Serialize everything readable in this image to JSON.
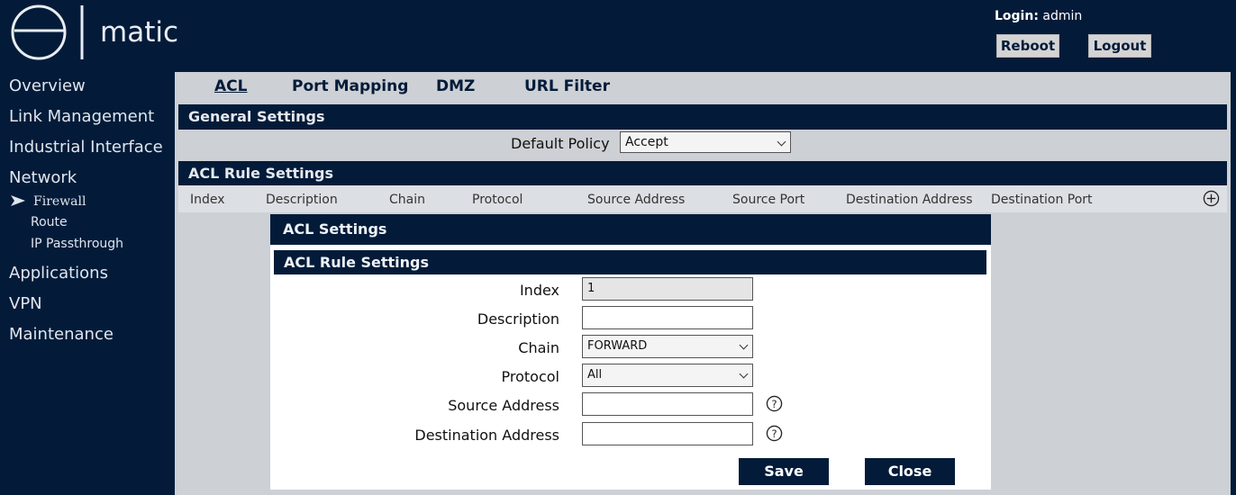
{
  "header": {
    "logo_text": "matic",
    "login_label": "Login:",
    "login_user": "admin",
    "reboot_label": "Reboot",
    "logout_label": "Logout"
  },
  "sidebar": {
    "items": [
      {
        "label": "Overview"
      },
      {
        "label": "Link Management"
      },
      {
        "label": "Industrial Interface"
      },
      {
        "label": "Network"
      },
      {
        "label": "Applications"
      },
      {
        "label": "VPN"
      },
      {
        "label": "Maintenance"
      }
    ],
    "subitems": [
      {
        "label": "Firewall",
        "active": true
      },
      {
        "label": "Route"
      },
      {
        "label": "IP Passthrough"
      }
    ]
  },
  "tabs": [
    {
      "label": "ACL",
      "active": true
    },
    {
      "label": "Port Mapping"
    },
    {
      "label": "DMZ"
    },
    {
      "label": "URL Filter"
    }
  ],
  "general": {
    "title": "General Settings",
    "policy_label": "Default Policy",
    "policy_value": "Accept"
  },
  "acl_rules": {
    "title": "ACL Rule Settings",
    "columns": [
      "Index",
      "Description",
      "Chain",
      "Protocol",
      "Source Address",
      "Source Port",
      "Destination Address",
      "Destination Port"
    ]
  },
  "modal": {
    "title": "ACL Settings",
    "subtitle": "ACL Rule Settings",
    "fields": {
      "index": {
        "label": "Index",
        "value": "1"
      },
      "description": {
        "label": "Description",
        "value": ""
      },
      "chain": {
        "label": "Chain",
        "value": "FORWARD"
      },
      "protocol": {
        "label": "Protocol",
        "value": "All"
      },
      "source": {
        "label": "Source Address",
        "value": ""
      },
      "destination": {
        "label": "Destination Address",
        "value": ""
      }
    },
    "save_label": "Save",
    "close_label": "Close"
  },
  "colors": {
    "navy": "#031b39",
    "panel": "#cdd0d4",
    "button_grey": "#d4d4d4"
  },
  "icons": {
    "add": "plus-circle-icon",
    "help": "question-circle-icon",
    "nav_arrow": "arrow-right-icon"
  }
}
